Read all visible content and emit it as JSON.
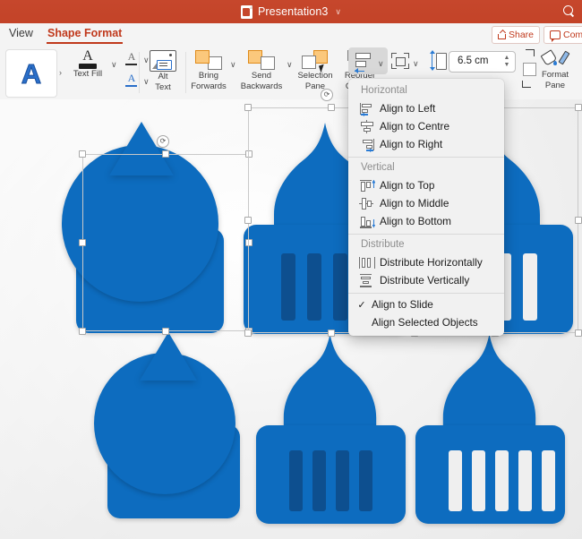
{
  "window": {
    "doc_title": "Presentation3",
    "doc_caret": "∨",
    "search_icon": "search-icon",
    "titlebar_color": "#c6472c"
  },
  "tabs": [
    {
      "label": "View",
      "active": false
    },
    {
      "label": "Shape Format",
      "active": true
    }
  ],
  "header_buttons": [
    {
      "label": "Share",
      "icon": "share-icon"
    },
    {
      "label": "Com",
      "icon": "comment-icon"
    }
  ],
  "ribbon": {
    "wordart": {
      "glyph": "A",
      "expand": "›"
    },
    "text_fill": {
      "label": "Text Fill",
      "caret": "∨"
    },
    "text_outline_caret": "∨",
    "text_effects_caret": "∨",
    "alt_text": {
      "line1": "Alt",
      "line2": "Text"
    },
    "bring_forwards": {
      "line1": "Bring",
      "line2": "Forwards",
      "caret": "∨"
    },
    "send_backwards": {
      "line1": "Send",
      "line2": "Backwards",
      "caret": "∨"
    },
    "selection_pane": {
      "line1": "Selection",
      "line2": "Pane"
    },
    "reorder_objects": {
      "line1": "Reorder",
      "line2": "Objects",
      "caret": "∨"
    },
    "align": {
      "name": "align-objects",
      "caret": "∨",
      "pressed": true
    },
    "group": {
      "name": "group-objects",
      "caret": "∨"
    },
    "height_field": {
      "value": "6.5 cm",
      "up": "▲",
      "down": "▼"
    },
    "format_pane": {
      "line1": "Format",
      "line2": "Pane"
    }
  },
  "align_menu": {
    "groups": [
      {
        "title": "Horizontal",
        "items": [
          {
            "label": "Align to Left",
            "icon": "align-left-icon"
          },
          {
            "label": "Align to Centre",
            "icon": "align-centre-icon"
          },
          {
            "label": "Align to Right",
            "icon": "align-right-icon"
          }
        ]
      },
      {
        "title": "Vertical",
        "items": [
          {
            "label": "Align to Top",
            "icon": "align-top-icon"
          },
          {
            "label": "Align to Middle",
            "icon": "align-middle-icon"
          },
          {
            "label": "Align to Bottom",
            "icon": "align-bottom-icon"
          }
        ]
      },
      {
        "title": "Distribute",
        "items": [
          {
            "label": "Distribute Horizontally",
            "icon": "distribute-horizontal-icon"
          },
          {
            "label": "Distribute Vertically",
            "icon": "distribute-vertical-icon"
          }
        ]
      }
    ],
    "options": [
      {
        "label": "Align to Slide",
        "checked": true,
        "check": "✓"
      },
      {
        "label": "Align Selected Objects",
        "checked": false,
        "check": ""
      }
    ]
  },
  "slide": {
    "shape_fill": "#0d6cbf",
    "shape_dark": "#0d4f8f",
    "shape_light": "#efefef",
    "shapes": [
      {
        "name": "capitol-shape-1-selected",
        "selected": true
      },
      {
        "name": "capitol-shape-2-selected",
        "selected": true
      },
      {
        "name": "capitol-shape-3-selected",
        "selected": true
      },
      {
        "name": "capitol-shape-4",
        "selected": false
      },
      {
        "name": "capitol-shape-5",
        "selected": false
      },
      {
        "name": "capitol-shape-6",
        "selected": false
      }
    ]
  }
}
